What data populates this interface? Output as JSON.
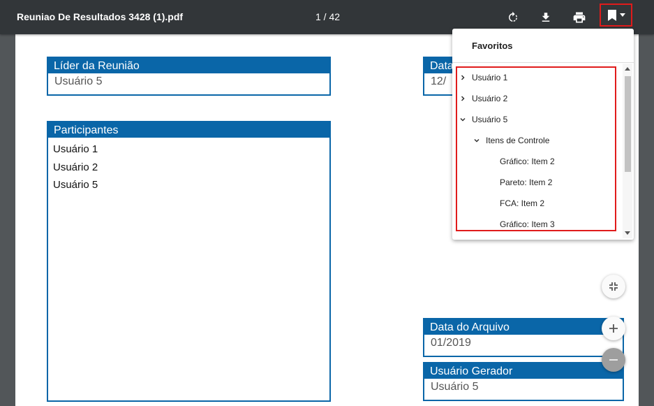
{
  "toolbar": {
    "title": "Reuniao De Resultados 3428 (1).pdf",
    "page_indicator": "1 / 42",
    "icons": [
      "rotate-icon",
      "download-icon",
      "print-icon",
      "bookmark-icon"
    ]
  },
  "document": {
    "leader": {
      "label": "Líder da Reunião",
      "value": "Usuário 5"
    },
    "date_partial": {
      "label": "Data",
      "value": "12/"
    },
    "participants": {
      "label": "Participantes",
      "items": [
        "Usuário 1",
        "Usuário 2",
        "Usuário 5"
      ]
    },
    "archive_date": {
      "label": "Data do Arquivo",
      "value": "01/2019"
    },
    "generator": {
      "label": "Usuário Gerador",
      "value": "Usuário 5"
    }
  },
  "bookmarks": {
    "title": "Favoritos",
    "items": [
      {
        "label": "Usuário 1",
        "state": "collapsed",
        "level": 0
      },
      {
        "label": "Usuário 2",
        "state": "collapsed",
        "level": 0
      },
      {
        "label": "Usuário 5",
        "state": "expanded",
        "level": 0
      },
      {
        "label": "Itens de Controle",
        "state": "expanded",
        "level": 1
      },
      {
        "label": "Gráfico: Item 2",
        "state": "leaf",
        "level": 2
      },
      {
        "label": "Pareto: Item 2",
        "state": "leaf",
        "level": 2
      },
      {
        "label": "FCA: Item 2",
        "state": "leaf",
        "level": 2
      },
      {
        "label": "Gráfico: Item 3",
        "state": "leaf",
        "level": 2
      }
    ]
  },
  "colors": {
    "accent": "#0a66a8",
    "highlight": "#e01b1b",
    "toolbar": "#323639"
  }
}
